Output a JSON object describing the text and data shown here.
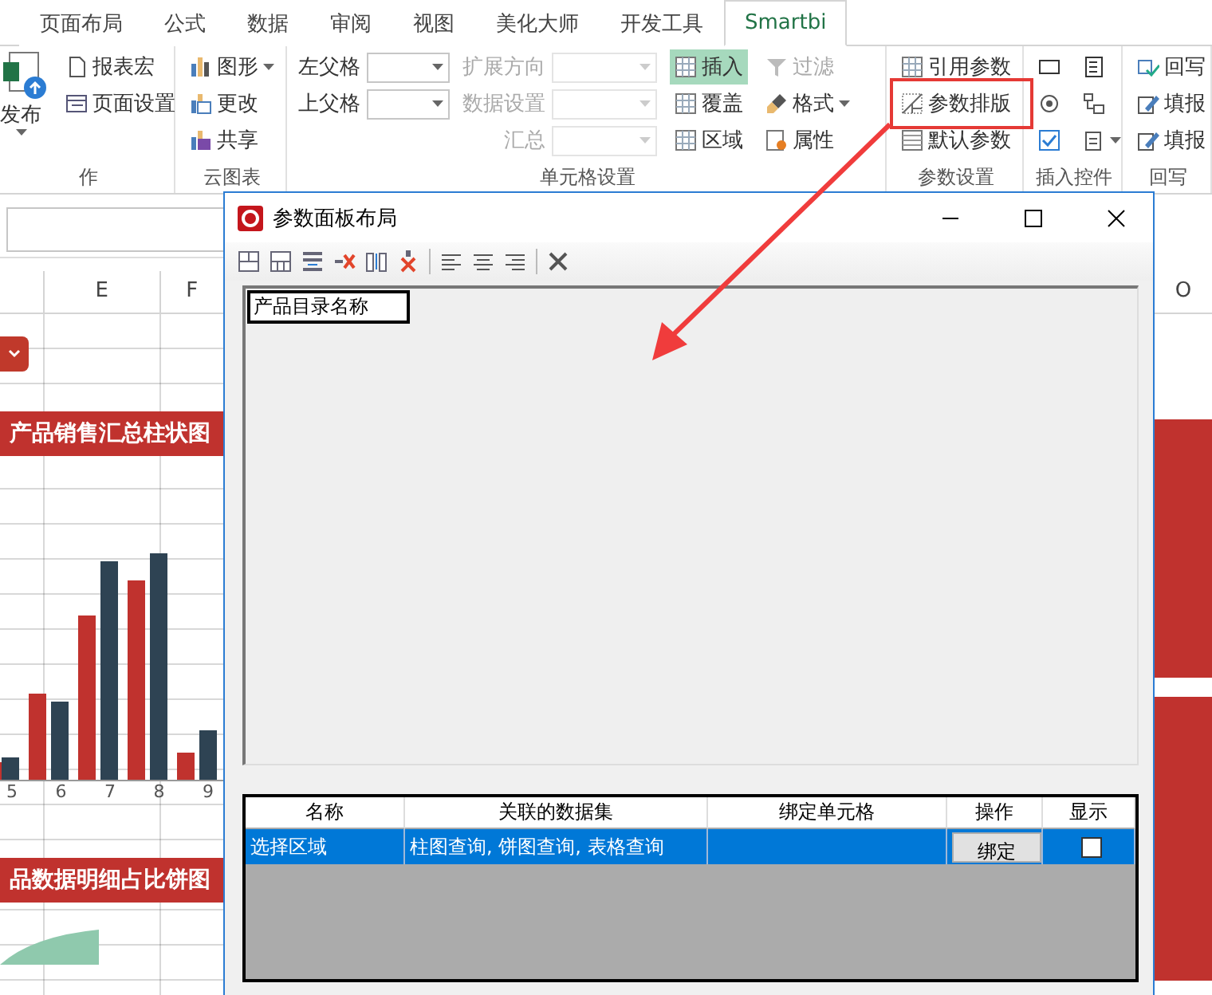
{
  "ribbon_tabs": [
    {
      "label": "页面布局",
      "selected": false
    },
    {
      "label": "公式",
      "selected": false
    },
    {
      "label": "数据",
      "selected": false
    },
    {
      "label": "审阅",
      "selected": false
    },
    {
      "label": "视图",
      "selected": false
    },
    {
      "label": "美化大师",
      "selected": false
    },
    {
      "label": "开发工具",
      "selected": false
    },
    {
      "label": "Smartbi",
      "selected": true
    }
  ],
  "ribbon_groups": [
    {
      "label": "作",
      "columns": [
        [
          {
            "kind": "big",
            "label": "发布"
          }
        ],
        [
          {
            "kind": "button",
            "label": "报表宏"
          },
          {
            "kind": "button",
            "label": "页面设置"
          }
        ]
      ]
    },
    {
      "label": "云图表",
      "columns": [
        [
          {
            "kind": "button",
            "label": "图形",
            "dropdown": true
          },
          {
            "kind": "button",
            "label": "更改"
          },
          {
            "kind": "button",
            "label": "共享"
          }
        ]
      ]
    },
    {
      "label": "单元格设置",
      "columns": [
        [
          {
            "kind": "combo",
            "label": "左父格",
            "disabled": false
          },
          {
            "kind": "combo",
            "label": "上父格",
            "disabled": false
          }
        ],
        [
          {
            "kind": "combo",
            "label": "扩展方向",
            "disabled": true
          },
          {
            "kind": "combo",
            "label": "数据设置",
            "disabled": true
          },
          {
            "kind": "combo",
            "label": "汇总",
            "disabled": true
          }
        ],
        [
          {
            "kind": "button",
            "label": "插入",
            "on": true
          },
          {
            "kind": "button",
            "label": "覆盖",
            "on": false
          },
          {
            "kind": "button",
            "label": "区域",
            "on": false
          }
        ],
        [
          {
            "kind": "button",
            "label": "过滤",
            "disabled": true
          },
          {
            "kind": "button",
            "label": "格式",
            "dropdown": true,
            "disabled": false
          },
          {
            "kind": "button",
            "label": "属性",
            "disabled": false
          }
        ]
      ]
    },
    {
      "label": "参数设置",
      "columns": [
        [
          {
            "kind": "button",
            "label": "引用参数"
          },
          {
            "kind": "button",
            "label": "参数排版",
            "highlighted": true
          },
          {
            "kind": "button",
            "label": "默认参数"
          }
        ]
      ]
    },
    {
      "label": "插入控件",
      "columns": [
        [
          {
            "kind": "icon"
          },
          {
            "kind": "icon"
          },
          {
            "kind": "icon"
          }
        ],
        [
          {
            "kind": "icon"
          },
          {
            "kind": "icon"
          },
          {
            "kind": "icon",
            "dropdown": true
          }
        ]
      ]
    },
    {
      "label": "回写",
      "columns": [
        [
          {
            "kind": "button",
            "label": "回写"
          },
          {
            "kind": "button",
            "label": "填报"
          },
          {
            "kind": "button",
            "label": "填报"
          }
        ]
      ]
    }
  ],
  "sheet": {
    "left_columns": [
      "E",
      "F"
    ],
    "right_columns": [
      "O"
    ],
    "banners": [
      "产品销售汇总柱状图",
      "品数据明细占比饼图"
    ],
    "chart_categories": [
      "5",
      "6",
      "7",
      "8",
      "9"
    ]
  },
  "dialog": {
    "title": "参数面板布局",
    "canvas_items": [
      {
        "label": "产品目录名称",
        "selected": true
      }
    ],
    "table": {
      "columns": [
        "名称",
        "关联的数据集",
        "绑定单元格",
        "操作",
        "显示"
      ],
      "rows": [
        {
          "name": "选择区域",
          "datasets": "柱图查询, 饼图查询, 表格查询",
          "action": "绑定",
          "show": false,
          "selected": true
        }
      ]
    }
  }
}
